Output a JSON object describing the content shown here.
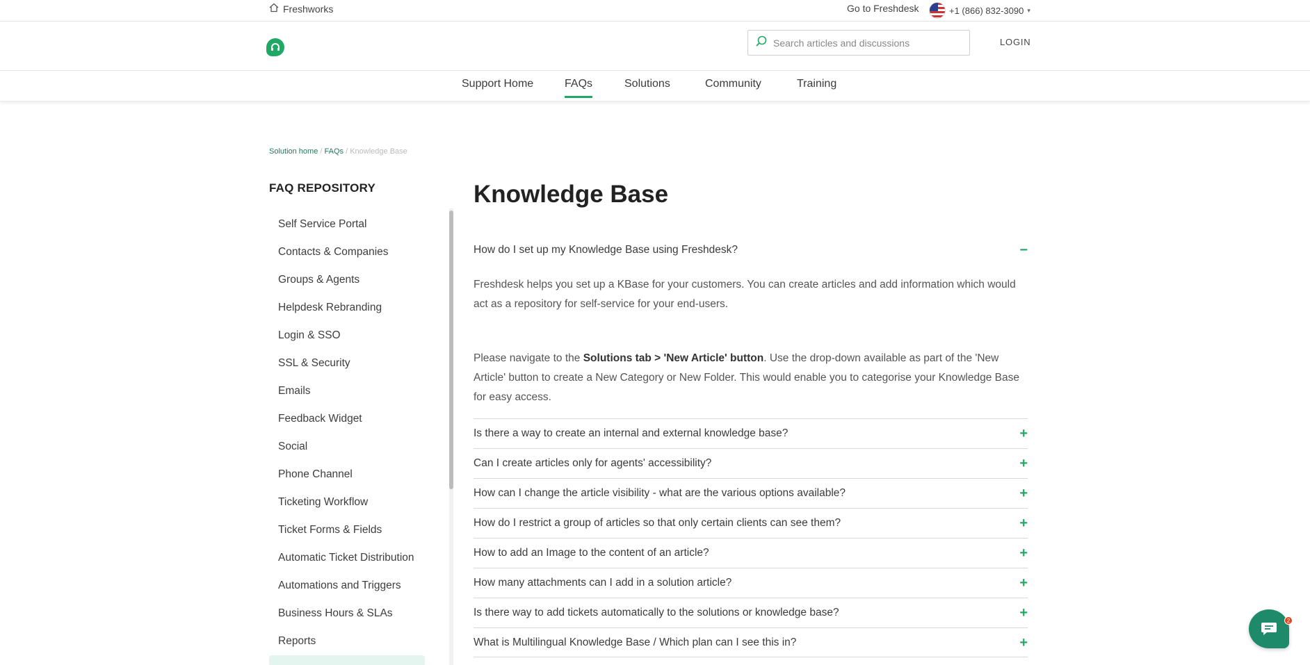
{
  "topbar": {
    "brand": "Freshworks",
    "goto": "Go to Freshdesk",
    "phone": "+1 (866) 832-3090"
  },
  "header": {
    "search_placeholder": "Search articles and discussions",
    "login": "LOGIN"
  },
  "nav": {
    "tabs": [
      {
        "label": "Support Home"
      },
      {
        "label": "FAQs",
        "active": true
      },
      {
        "label": "Solutions"
      },
      {
        "label": "Community"
      },
      {
        "label": "Training"
      }
    ]
  },
  "breadcrumb": {
    "home": "Solution home",
    "sep1": "/",
    "faqs": "FAQs",
    "sep2": "/",
    "current": "Knowledge Base"
  },
  "sidebar": {
    "title": "FAQ REPOSITORY",
    "items": [
      {
        "label": "Self Service Portal"
      },
      {
        "label": "Contacts & Companies"
      },
      {
        "label": "Groups & Agents"
      },
      {
        "label": "Helpdesk Rebranding"
      },
      {
        "label": "Login & SSO"
      },
      {
        "label": "SSL & Security"
      },
      {
        "label": "Emails"
      },
      {
        "label": "Feedback Widget"
      },
      {
        "label": "Social"
      },
      {
        "label": "Phone Channel"
      },
      {
        "label": "Ticketing Workflow"
      },
      {
        "label": "Ticket Forms & Fields"
      },
      {
        "label": "Automatic Ticket Distribution"
      },
      {
        "label": "Automations and Triggers"
      },
      {
        "label": "Business Hours & SLAs"
      },
      {
        "label": "Reports"
      }
    ]
  },
  "main": {
    "title": "Knowledge Base",
    "open_faq": {
      "question": "How do I set up my Knowledge Base using Freshdesk?",
      "answer_p1": "Freshdesk helps you set up a KBase for your customers. You can create articles and add information which would act as a repository for self-service for your end-users.",
      "answer_p2_pre": "Please navigate to the ",
      "answer_p2_bold": "Solutions tab > 'New Article' button",
      "answer_p2_post": ". Use the drop-down available as part of the 'New Article' button to create a New Category or New Folder. This would enable you to categorise your Knowledge Base for easy access."
    },
    "faqs": [
      {
        "question": "Is there a way to create an internal and external knowledge base?"
      },
      {
        "question": "Can I create articles only for agents' accessibility?"
      },
      {
        "question": "How can I change the article visibility - what are the various options available?"
      },
      {
        "question": "How do I restrict a group of articles so that only certain clients can see them?"
      },
      {
        "question": "How to add an Image to the content of an article?"
      },
      {
        "question": "How many attachments can I add in a solution article?"
      },
      {
        "question": "Is there way to add tickets automatically to the solutions or knowledge base?"
      },
      {
        "question": "What is Multilingual Knowledge Base / Which plan can I see this in?"
      }
    ]
  },
  "chat": {
    "badge": "2"
  },
  "colors": {
    "accent": "#22a865",
    "link": "#1f7a5a",
    "chat": "#1e8a6a"
  }
}
